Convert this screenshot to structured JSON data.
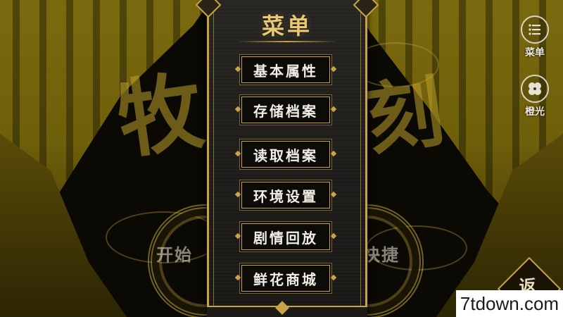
{
  "panel": {
    "title": "菜单",
    "items": [
      {
        "label": "基本属性"
      },
      {
        "label": "存储档案"
      },
      {
        "label": "读取档案"
      },
      {
        "label": "环境设置"
      },
      {
        "label": "剧情回放"
      },
      {
        "label": "鲜花商城"
      }
    ]
  },
  "side_buttons": {
    "menu": {
      "label": "菜单",
      "icon": "list-icon"
    },
    "light": {
      "label": "橙光",
      "icon": "orange-flower-icon"
    }
  },
  "background": {
    "title_left_char": "牧",
    "title_right_char": "刻",
    "left_button_text": "开始",
    "right_button_text": "快捷"
  },
  "return_button": {
    "label": "返"
  },
  "watermark": {
    "text": "7tdown.com"
  },
  "colors": {
    "gold": "#c9a447",
    "title_gold": "#e8c873",
    "panel_bg": "#1e1d1a",
    "curtain": "#6e5f0a"
  }
}
